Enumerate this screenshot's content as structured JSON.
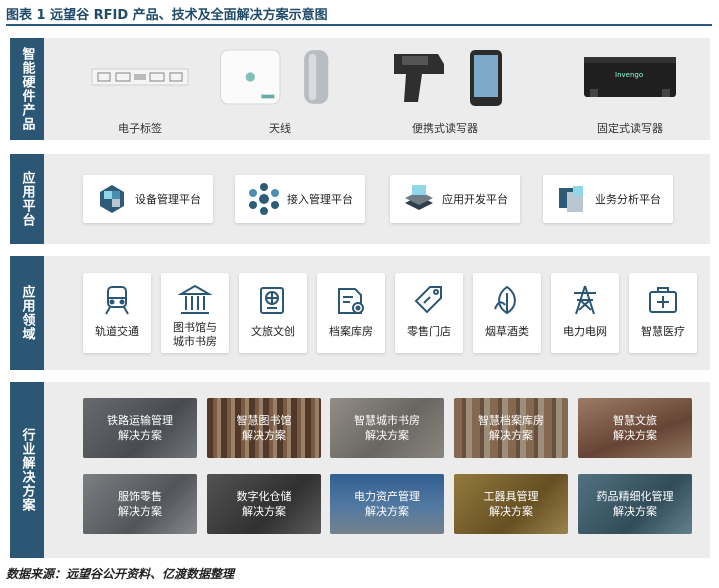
{
  "figure": {
    "title": "图表 1 远望谷 RFID 产品、技术及全面解决方案示意图",
    "source": "数据来源：远望谷公开资料、亿渡数据整理"
  },
  "colors": {
    "label_bg": "#2b5775",
    "band_bg": "#ececec",
    "icon": "#2b5775"
  },
  "sections": {
    "hardware": {
      "label": "智能硬件产品",
      "items": [
        {
          "label": "电子标签",
          "icon": "rfid-tag-icon"
        },
        {
          "label": "天线",
          "icon": "antenna-icon"
        },
        {
          "label": "便携式读写器",
          "icon": "handheld-reader-icon"
        },
        {
          "label": "固定式读写器",
          "icon": "fixed-reader-icon"
        }
      ],
      "device_brand": "Invengo"
    },
    "platforms": {
      "label": "应用平台",
      "items": [
        {
          "label": "设备管理平台",
          "icon": "device-management-icon"
        },
        {
          "label": "接入管理平台",
          "icon": "access-management-icon"
        },
        {
          "label": "应用开发平台",
          "icon": "app-development-icon"
        },
        {
          "label": "业务分析平台",
          "icon": "business-analysis-icon"
        }
      ]
    },
    "domains": {
      "label": "应用领域",
      "items": [
        {
          "label": "轨道交通",
          "icon": "train-icon"
        },
        {
          "label": "图书馆与\n城市书房",
          "icon": "library-icon"
        },
        {
          "label": "文旅文创",
          "icon": "globe-passport-icon"
        },
        {
          "label": "档案库房",
          "icon": "archive-icon"
        },
        {
          "label": "零售门店",
          "icon": "price-tag-icon"
        },
        {
          "label": "烟草酒类",
          "icon": "leaf-icon"
        },
        {
          "label": "电力电网",
          "icon": "power-tower-icon"
        },
        {
          "label": "智慧医疗",
          "icon": "medical-kit-icon"
        }
      ]
    },
    "solutions": {
      "label": "行业解决方案",
      "items": [
        {
          "label": "铁路运输管理\n解决方案"
        },
        {
          "label": "智慧图书馆\n解决方案"
        },
        {
          "label": "智慧城市书房\n解决方案"
        },
        {
          "label": "智慧档案库房\n解决方案"
        },
        {
          "label": "智慧文旅\n解决方案"
        },
        {
          "label": "服饰零售\n解决方案"
        },
        {
          "label": "数字化仓储\n解决方案"
        },
        {
          "label": "电力资产管理\n解决方案"
        },
        {
          "label": "工器具管理\n解决方案"
        },
        {
          "label": "药品精细化管理\n解决方案"
        }
      ]
    }
  }
}
